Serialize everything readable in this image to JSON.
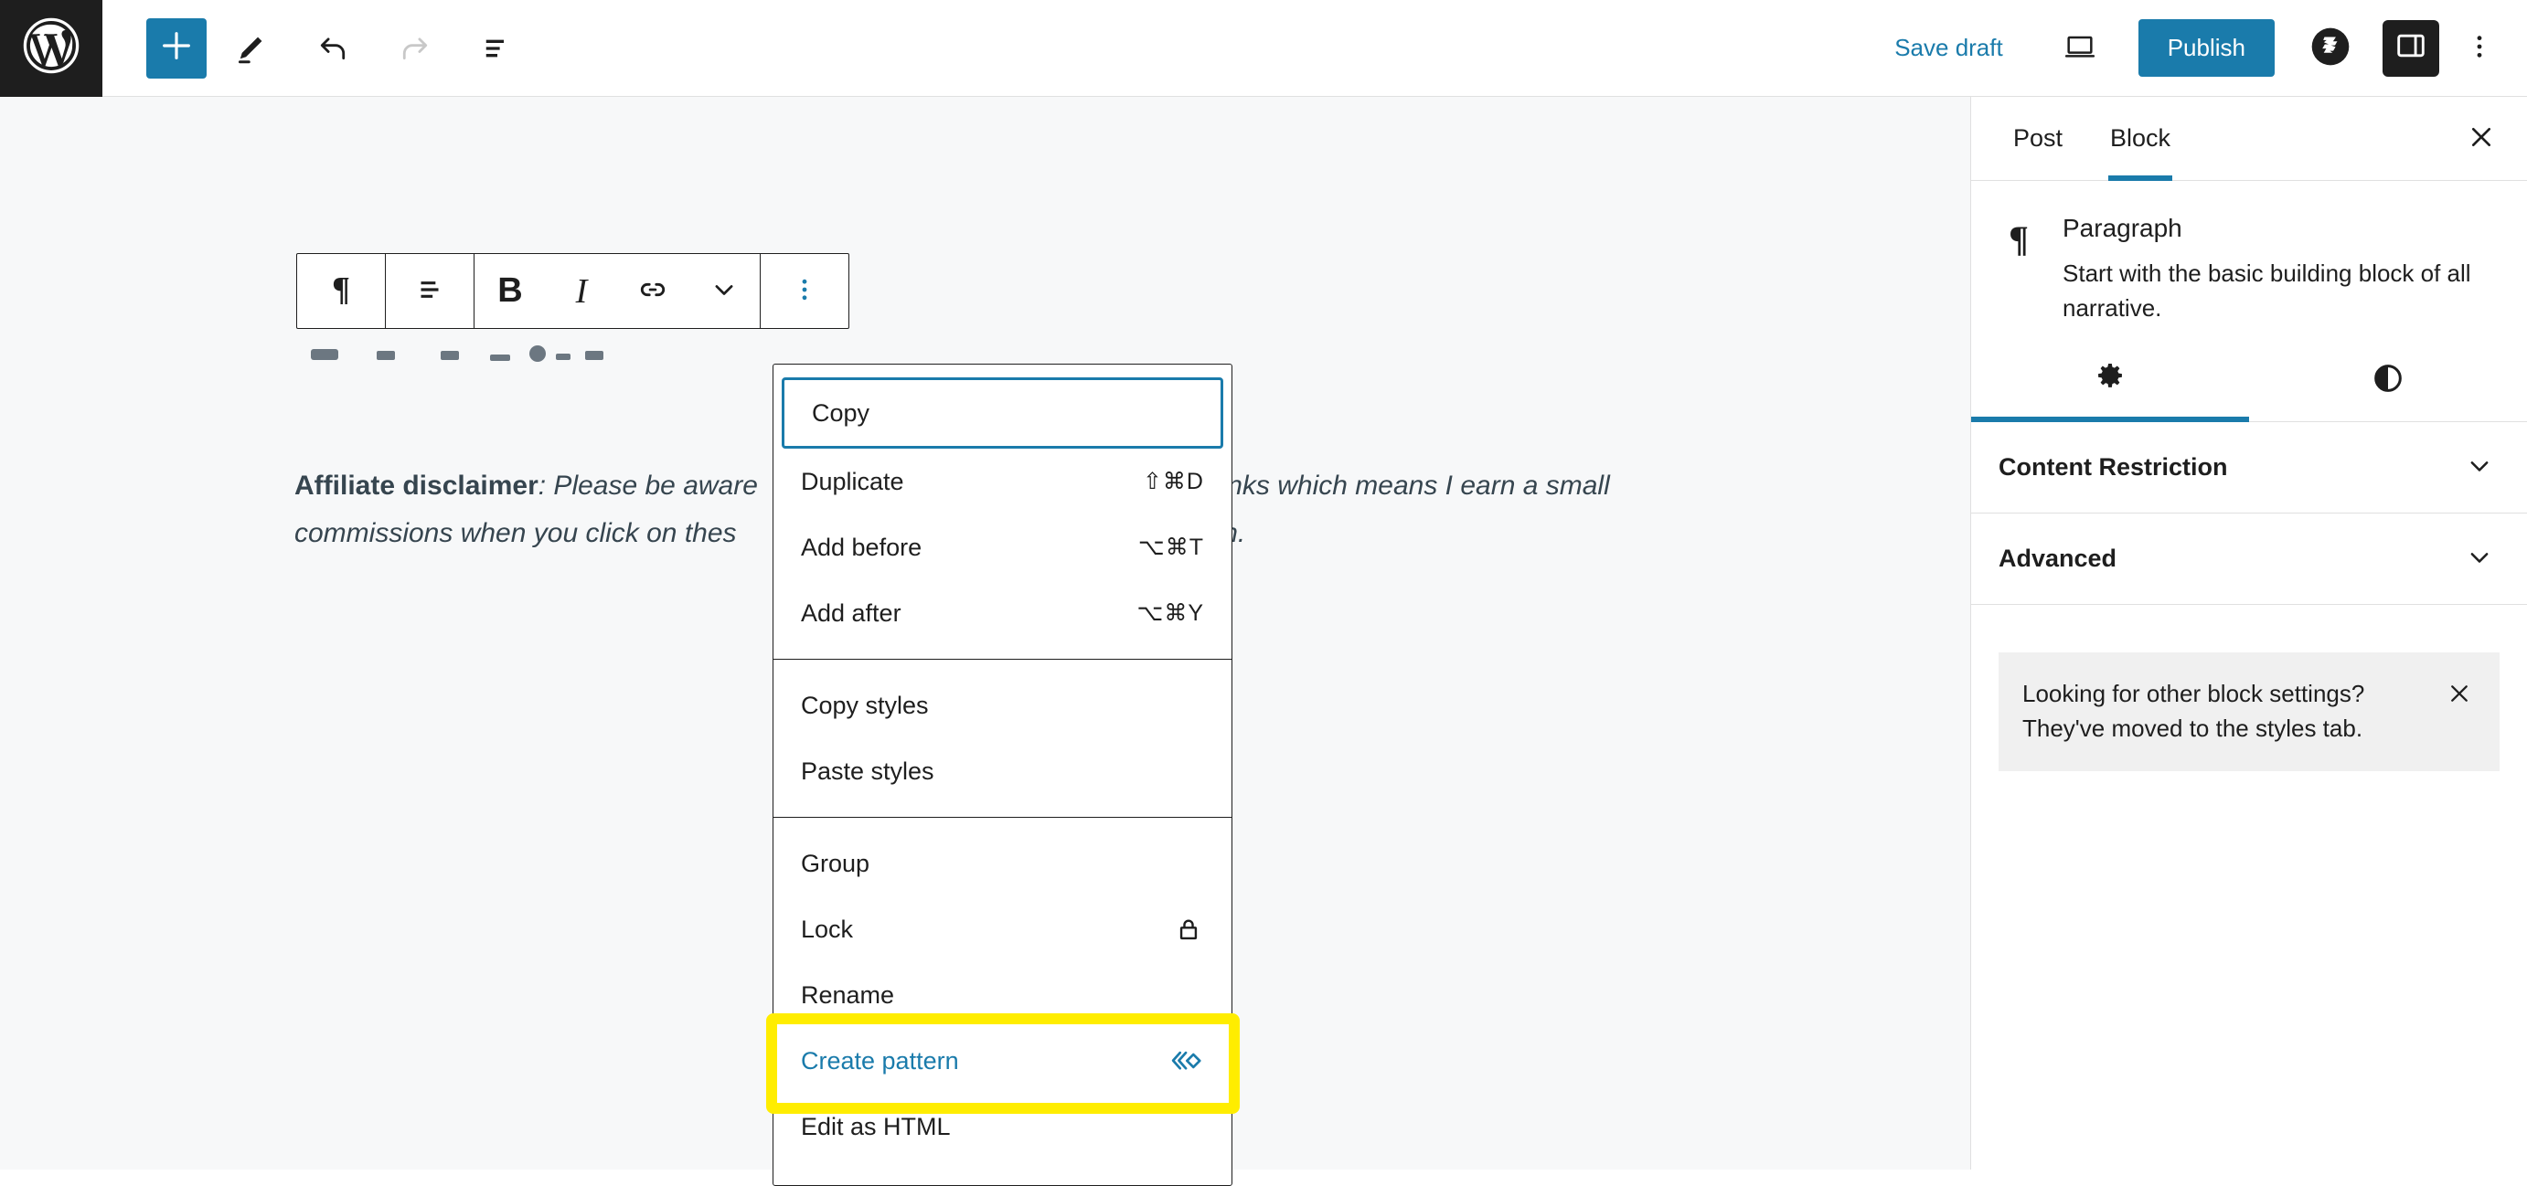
{
  "toolbar": {
    "logo_icon": "wordpress-logo-icon",
    "add_block_icon": "plus-icon",
    "tools_icon": "pencil-edit-icon",
    "undo_icon": "undo-arrow-icon",
    "redo_icon": "redo-arrow-icon",
    "list_view_icon": "document-overview-icon",
    "save_draft_label": "Save draft",
    "preview_icon": "laptop-preview-icon",
    "publish_label": "Publish",
    "plugin_badge_icon": "plugin-badge-b-icon",
    "sidebar_toggle_icon": "sidebar-panel-icon",
    "more_options_icon": "vertical-ellipsis-icon"
  },
  "block_toolbar": {
    "items": [
      {
        "name": "paragraph-type",
        "icon": "pilcrow-icon"
      },
      {
        "name": "align",
        "icon": "align-left-icon"
      },
      {
        "name": "bold",
        "icon": "bold-icon",
        "glyph": "B"
      },
      {
        "name": "italic",
        "icon": "italic-icon",
        "glyph": "I"
      },
      {
        "name": "link",
        "icon": "link-chain-icon"
      },
      {
        "name": "more-formats",
        "icon": "chevron-down-icon"
      },
      {
        "name": "block-options",
        "icon": "vertical-ellipsis-icon"
      }
    ]
  },
  "editor": {
    "paragraph": {
      "bold_lead": "Affiliate disclaimer",
      "line1_after_lead": ": Please be aware",
      "line1_tail": "links which means I earn a small",
      "line2_head": "commissions when you click on thes",
      "line2_tail": "tion."
    }
  },
  "block_menu": {
    "sections": [
      {
        "items": [
          {
            "label": "Copy",
            "shortcut": "",
            "icon": "",
            "state": "focused"
          },
          {
            "label": "Duplicate",
            "shortcut": "⇧⌘D",
            "icon": "",
            "state": "normal"
          },
          {
            "label": "Add before",
            "shortcut": "⌥⌘T",
            "icon": "",
            "state": "normal"
          },
          {
            "label": "Add after",
            "shortcut": "⌥⌘Y",
            "icon": "",
            "state": "normal"
          }
        ]
      },
      {
        "items": [
          {
            "label": "Copy styles",
            "shortcut": "",
            "icon": "",
            "state": "normal"
          },
          {
            "label": "Paste styles",
            "shortcut": "",
            "icon": "",
            "state": "normal"
          }
        ]
      },
      {
        "items": [
          {
            "label": "Group",
            "shortcut": "",
            "icon": "",
            "state": "normal"
          },
          {
            "label": "Lock",
            "shortcut": "",
            "icon": "lock-icon",
            "state": "normal"
          },
          {
            "label": "Rename",
            "shortcut": "",
            "icon": "",
            "state": "normal"
          },
          {
            "label": "Create pattern",
            "shortcut": "",
            "icon": "create-pattern-icon",
            "state": "blue"
          },
          {
            "label": "Edit as HTML",
            "shortcut": "",
            "icon": "",
            "state": "normal"
          }
        ]
      }
    ],
    "highlight": {
      "target_label": "Create pattern",
      "color": "#ffed00"
    }
  },
  "sidebar": {
    "tabs": [
      {
        "label": "Post",
        "active": false
      },
      {
        "label": "Block",
        "active": true
      }
    ],
    "close_icon": "close-x-icon",
    "block_card": {
      "icon": "pilcrow-icon",
      "title": "Paragraph",
      "description": "Start with the basic building block of all narrative."
    },
    "inspector_tabs": [
      {
        "name": "settings",
        "icon": "gear-icon",
        "active": true
      },
      {
        "name": "styles",
        "icon": "contrast-half-circle-icon",
        "active": false
      }
    ],
    "panels": [
      {
        "title": "Content Restriction",
        "icon": "chevron-down-icon"
      },
      {
        "title": "Advanced",
        "icon": "chevron-down-icon"
      }
    ],
    "notice": {
      "line1": "Looking for other block settings?",
      "line2": "They've moved to the styles tab.",
      "close_icon": "close-x-icon"
    }
  },
  "colors": {
    "accent": "#1a7bab",
    "dark": "#1e1e1e",
    "canvas_bg": "#f7f8f9",
    "highlight_yellow": "#ffed00",
    "text": "#36454f"
  }
}
